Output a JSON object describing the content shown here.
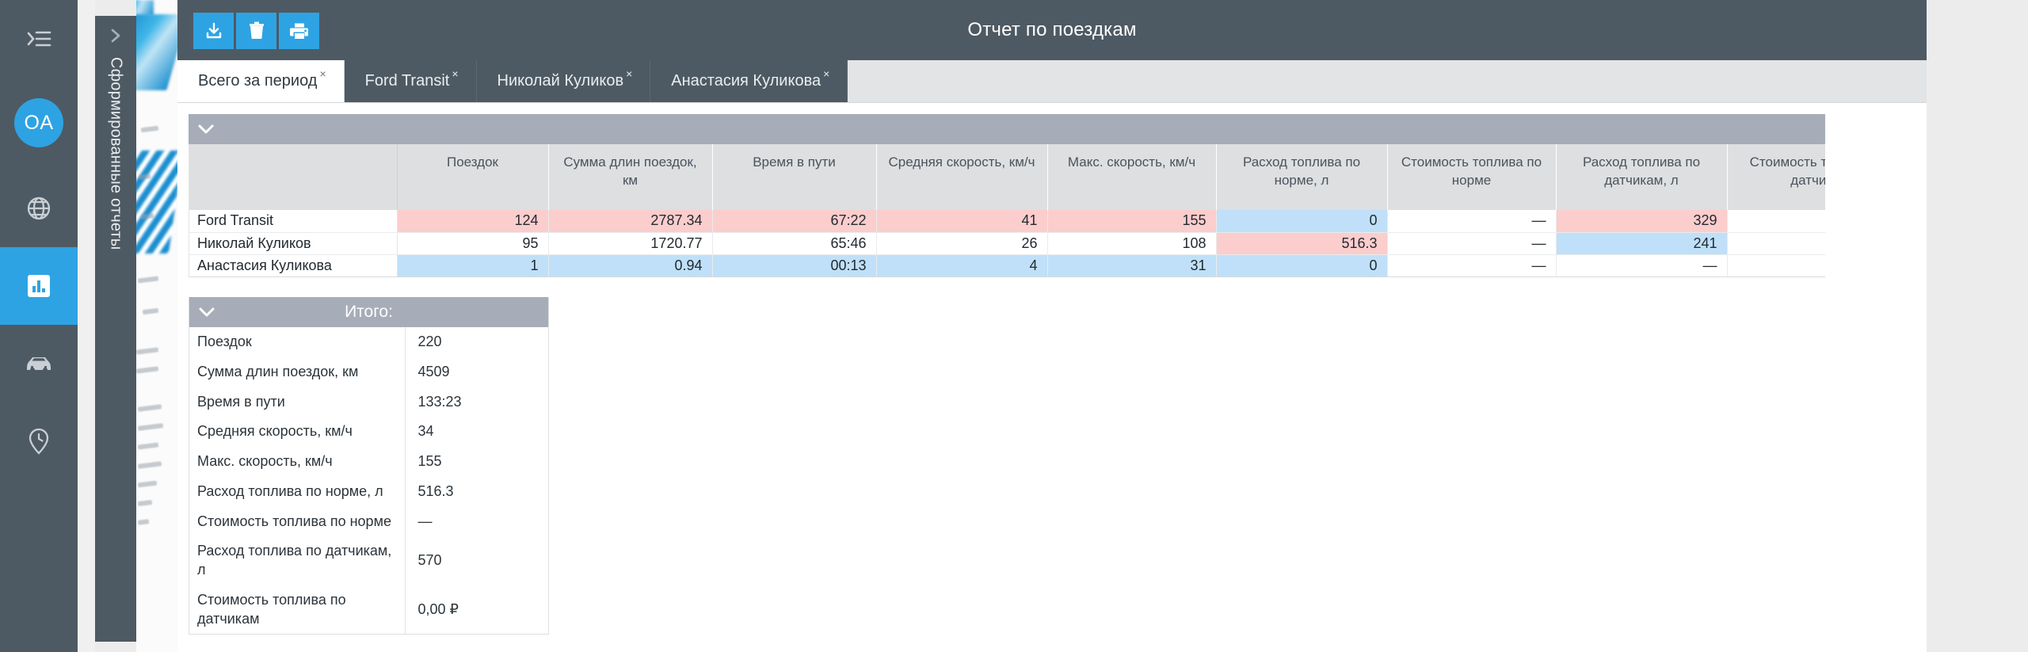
{
  "rail": {
    "menu_icon": "hamburger-collapse-icon",
    "avatar_initials": "OA",
    "items": [
      {
        "icon": "globe-icon",
        "active": false
      },
      {
        "icon": "bar-chart-icon",
        "active": true
      },
      {
        "icon": "car-icon",
        "active": false
      },
      {
        "icon": "clock-pin-icon",
        "active": false
      }
    ]
  },
  "drawer": {
    "label": "Сформированные отчеты",
    "expand_icon": "chevron-right-icon"
  },
  "header": {
    "title": "Отчет по поездкам",
    "toolbar": [
      {
        "name": "download-button",
        "icon": "download-icon"
      },
      {
        "name": "delete-button",
        "icon": "trash-icon"
      },
      {
        "name": "print-button",
        "icon": "printer-icon"
      }
    ]
  },
  "tabs": [
    {
      "label": "Всего за период",
      "close": "×",
      "active": true
    },
    {
      "label": "Ford Transit",
      "close": "×",
      "active": false
    },
    {
      "label": "Николай Куликов",
      "close": "×",
      "active": false
    },
    {
      "label": "Анастасия Куликова",
      "close": "×",
      "active": false
    }
  ],
  "grid": {
    "section_title": "",
    "collapse_icon": "chevron-down-icon",
    "columns": [
      "",
      "Поездок",
      "Сумма длин поездок, км",
      "Время в пути",
      "Средняя скорость, км/ч",
      "Макс. скорость, км/ч",
      "Расход топлива по норме, л",
      "Стоимость топлива по норме",
      "Расход топлива по датчикам, л",
      "Стоимость топлива по датчикам"
    ],
    "rows": [
      {
        "name": "Ford Transit",
        "cells": [
          "124",
          "2787.34",
          "67:22",
          "41",
          "155",
          "0",
          "—",
          "329",
          "—"
        ],
        "marks": [
          "max",
          "max",
          "max",
          "max",
          "max",
          "min",
          "none",
          "max",
          "none"
        ]
      },
      {
        "name": "Николай Куликов",
        "cells": [
          "95",
          "1720.77",
          "65:46",
          "26",
          "108",
          "516.3",
          "—",
          "241",
          "—"
        ],
        "marks": [
          "none",
          "none",
          "none",
          "none",
          "none",
          "max",
          "none",
          "min",
          "none"
        ]
      },
      {
        "name": "Анастасия Куликова",
        "cells": [
          "1",
          "0.94",
          "00:13",
          "4",
          "31",
          "0",
          "—",
          "—",
          "—"
        ],
        "marks": [
          "min",
          "min",
          "min",
          "min",
          "min",
          "min",
          "none",
          "none",
          "none"
        ]
      }
    ]
  },
  "totals": {
    "title": "Итого:",
    "collapse_icon": "chevron-down-icon",
    "rows": [
      {
        "key": "Поездок",
        "value": "220"
      },
      {
        "key": "Сумма длин поездок, км",
        "value": "4509"
      },
      {
        "key": "Время в пути",
        "value": "133:23"
      },
      {
        "key": "Средняя скорость, км/ч",
        "value": "34"
      },
      {
        "key": "Макс. скорость, км/ч",
        "value": "155"
      },
      {
        "key": "Расход топлива по норме, л",
        "value": "516.3"
      },
      {
        "key": "Стоимость топлива по норме",
        "value": "—"
      },
      {
        "key": "Расход топлива по датчикам, л",
        "value": "570"
      },
      {
        "key": "Стоимость топлива по датчикам",
        "value": "0,00 ₽"
      }
    ]
  },
  "colors": {
    "rail_bg": "#4e5a63",
    "accent": "#2ea3e3",
    "section_bar": "#a7adb8",
    "header_cell": "#dddfe1",
    "highlight_max": "#fbcdcd",
    "highlight_min": "#bfe0f8",
    "page_bg": "#ececec"
  }
}
